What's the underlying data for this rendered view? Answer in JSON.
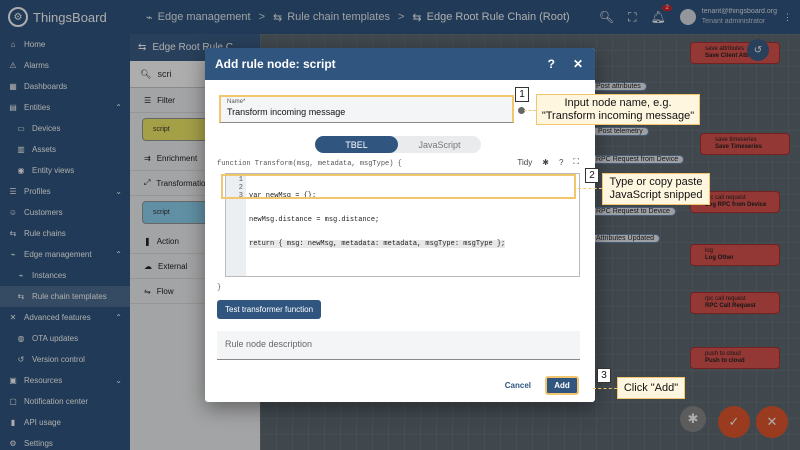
{
  "app": {
    "brand": "ThingsBoard",
    "breadcrumbs": [
      {
        "label": "Edge management",
        "icon": "edge-icon"
      },
      {
        "label": "Rule chain templates",
        "icon": "rule-chain-icon"
      },
      {
        "label": "Edge Root Rule Chain (Root)",
        "icon": "rule-chain-icon"
      }
    ],
    "notification_count": "2",
    "user": {
      "email": "tenant@thingsboard.org",
      "role": "Tenant administrator"
    }
  },
  "sidebar": {
    "items": [
      {
        "label": "Home",
        "icon": "home-icon"
      },
      {
        "label": "Alarms",
        "icon": "alarm-icon"
      },
      {
        "label": "Dashboards",
        "icon": "dashboard-icon"
      },
      {
        "label": "Entities",
        "icon": "entities-icon"
      },
      {
        "label": "Devices",
        "icon": "device-icon"
      },
      {
        "label": "Assets",
        "icon": "asset-icon"
      },
      {
        "label": "Entity views",
        "icon": "entity-view-icon"
      },
      {
        "label": "Profiles",
        "icon": "profile-icon"
      },
      {
        "label": "Customers",
        "icon": "customers-icon"
      },
      {
        "label": "Rule chains",
        "icon": "rule-chain-icon"
      },
      {
        "label": "Edge management",
        "icon": "edge-icon"
      },
      {
        "label": "Instances",
        "icon": "instance-icon"
      },
      {
        "label": "Rule chain templates",
        "icon": "rule-chain-icon"
      },
      {
        "label": "Advanced features",
        "icon": "advanced-icon"
      },
      {
        "label": "OTA updates",
        "icon": "ota-icon"
      },
      {
        "label": "Version control",
        "icon": "version-icon"
      },
      {
        "label": "Resources",
        "icon": "resources-icon"
      },
      {
        "label": "Notification center",
        "icon": "notification-icon"
      },
      {
        "label": "API usage",
        "icon": "api-icon"
      },
      {
        "label": "Settings",
        "icon": "settings-icon"
      }
    ]
  },
  "rule_panel": {
    "title": "Edge Root Rule C",
    "search_value": "scri",
    "filter_label": "Filter",
    "filter_node": "script",
    "enrichment_label": "Enrichment",
    "transformation_label": "Transformation",
    "transformation_node": "script",
    "action_label": "Action",
    "external_label": "External",
    "flow_label": "Flow"
  },
  "canvas": {
    "nodes": [
      {
        "type": "save attributes",
        "name": "Save Client Attributes"
      },
      {
        "type": "save timeseries",
        "name": "Save Timeseries"
      },
      {
        "type": "rpc call request",
        "name": "Log RPC from Device"
      },
      {
        "type": "log",
        "name": "Log Other"
      },
      {
        "type": "rpc call request",
        "name": "RPC Call Request"
      },
      {
        "type": "push to cloud",
        "name": "Push to cloud"
      }
    ],
    "edges": [
      "Post attributes",
      "Post telemetry",
      "RPC Request from Device",
      "RPC Request to Device",
      "Attributes Updated"
    ]
  },
  "dialog": {
    "title": "Add rule node: script",
    "name_label": "Name*",
    "name_value": "Transform incoming message",
    "lang_tbel": "TBEL",
    "lang_js": "JavaScript",
    "fn_signature": "function Transform(msg, metadata, msgType) {",
    "tidy_label": "Tidy",
    "code_lines": [
      "var newMsg = {};",
      "newMsg.distance = msg.distance;",
      "return { msg: newMsg, metadata: metadata, msgType: msgType };"
    ],
    "close_brace": "}",
    "test_button": "Test transformer function",
    "description_placeholder": "Rule node description",
    "cancel_label": "Cancel",
    "add_label": "Add"
  },
  "callouts": [
    {
      "num": "1",
      "text": "Input node name, e.g. \"Transform incoming message\""
    },
    {
      "num": "2",
      "text": "Type or copy paste JavaScript snipped"
    },
    {
      "num": "3",
      "text": "Click \"Add\""
    }
  ],
  "colors": {
    "primary": "#305680",
    "highlight": "#f2c56f",
    "node_red": "#d9534f",
    "fab_orange": "#e4572e"
  }
}
